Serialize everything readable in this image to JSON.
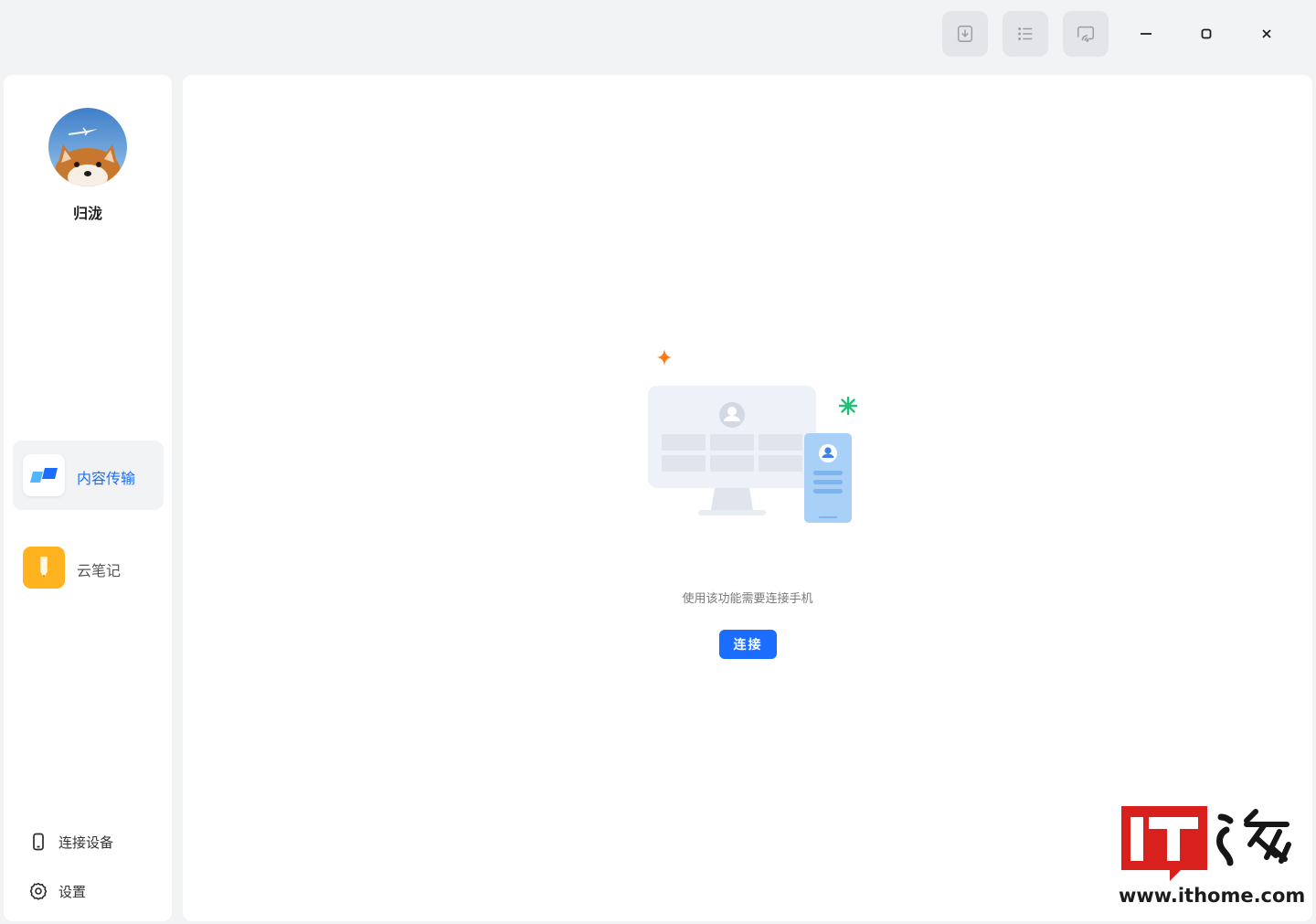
{
  "titlebar": {
    "buttons": [
      {
        "icon": "download-icon"
      },
      {
        "icon": "list-icon"
      },
      {
        "icon": "screen-cast-icon"
      }
    ],
    "window_controls": [
      "minimize-icon",
      "maximize-icon",
      "close-icon"
    ]
  },
  "sidebar": {
    "user": {
      "name": "归泷",
      "avatar": "shiba-dog-avatar"
    },
    "items": [
      {
        "label": "内容传输",
        "icon": "content-transfer-icon",
        "active": true,
        "color": "#1a6dff"
      },
      {
        "label": "云笔记",
        "icon": "cloud-note-icon",
        "active": false,
        "color": "#ffb41f"
      }
    ],
    "bottom": [
      {
        "label": "连接设备",
        "icon": "phone-icon"
      },
      {
        "label": "设置",
        "icon": "gear-icon"
      }
    ]
  },
  "main": {
    "empty_state": {
      "illustration": "computer-phone-illustration",
      "message": "使用该功能需要连接手机",
      "button_label": "连接"
    }
  },
  "watermark": {
    "logo": "IT之家",
    "url": "www.ithome.com"
  },
  "colors": {
    "accent": "#1a6dff",
    "background": "#f2f3f5",
    "panel": "#ffffff"
  }
}
